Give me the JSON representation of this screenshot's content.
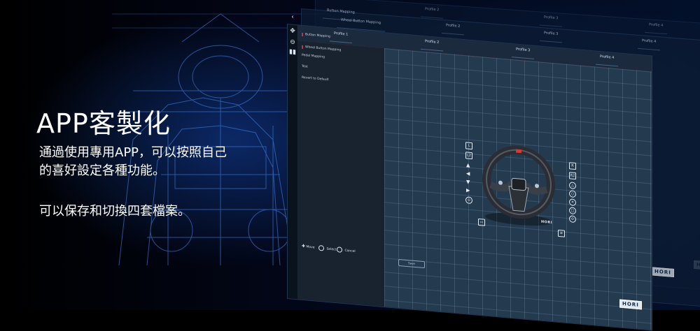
{
  "hero": {
    "title": "APP客製化",
    "desc_line1": "通過使用專用APP，可以按照自己",
    "desc_line2": "的喜好設定各種功能。",
    "desc_line3": "可以保存和切換四套檔案。"
  },
  "app": {
    "back_window": {
      "breadcrumb": "Button Mapping",
      "sub_breadcrumb": "Wheel Button Mapping",
      "profiles": [
        "Profile 1",
        "Profile 2",
        "Profile 3",
        "Profile 4"
      ]
    },
    "main_window": {
      "profiles": [
        "Profile 1",
        "Profile 2",
        "Profile 3",
        "Profile 4"
      ],
      "menu": {
        "section": "Button Mapping",
        "items": [
          "Wheel Button Mapping",
          "Pedal Mapping",
          "Test",
          "Revert to Default"
        ]
      },
      "hints": {
        "move": "Move",
        "select": "Select",
        "cancel": "Cancel"
      },
      "save_button": "Save",
      "badge": "HORI",
      "wheel_logo": "HORI"
    }
  },
  "colors": {
    "accent": "#c8323a",
    "canvas": "#243a4f",
    "text": "#ffffff"
  }
}
